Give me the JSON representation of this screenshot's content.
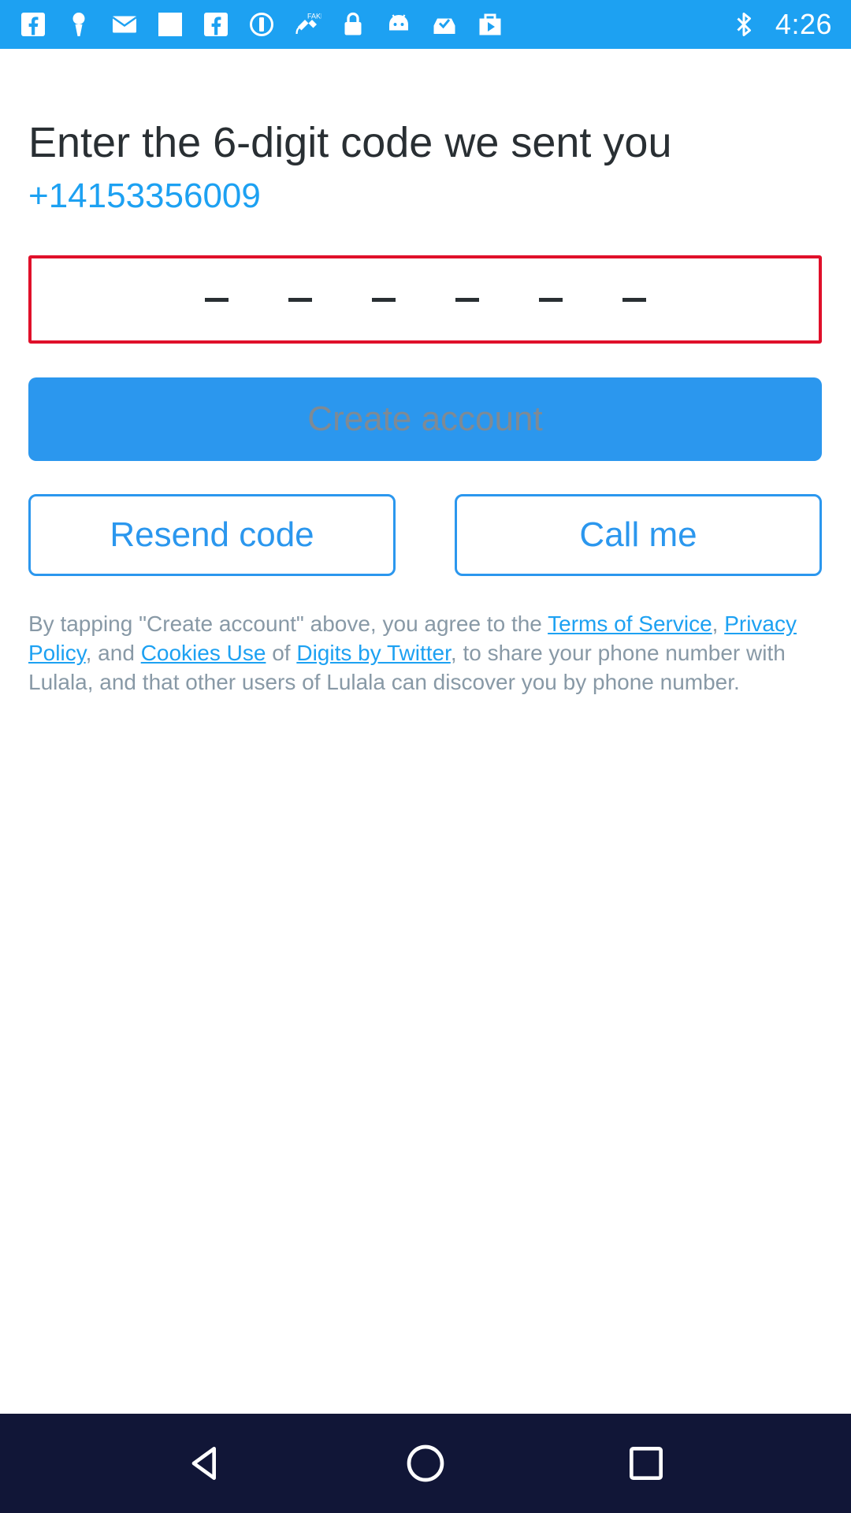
{
  "status_bar": {
    "time": "4:26",
    "left_icons": [
      "facebook-icon",
      "notification-icon",
      "mail-icon",
      "blank-card-icon",
      "facebook-icon",
      "info-icon",
      "satellite-icon",
      "lock-icon",
      "android-icon",
      "inbox-check-icon",
      "play-store-icon"
    ],
    "right_icons": [
      "bluetooth-icon"
    ],
    "background_color": "#1da1f2"
  },
  "main": {
    "title": "Enter the 6-digit code we sent you",
    "phone_number": "+14153356009",
    "code_input": {
      "value": "",
      "slot_count": 6,
      "border_color": "#e0102a"
    },
    "create_account_label": "Create account",
    "resend_code_label": "Resend code",
    "call_me_label": "Call me",
    "terms": {
      "part1": "By tapping \"Create account\" above, you agree to the ",
      "terms_link": "Terms of Service",
      "part2": ", ",
      "privacy_link": "Privacy Policy",
      "part3": ", and ",
      "cookies_link": "Cookies Use",
      "part4": " of ",
      "digits_link": "Digits by Twitter",
      "part5": ", to share your phone number with Lulala, and that other users of Lulala can discover you by phone number."
    }
  },
  "nav_bar": {
    "buttons": [
      "back-icon",
      "home-icon",
      "recents-icon"
    ]
  },
  "colors": {
    "accent": "#1da1f2",
    "button_fill": "#2b97ee",
    "error": "#e0102a",
    "nav_background": "#111637"
  }
}
